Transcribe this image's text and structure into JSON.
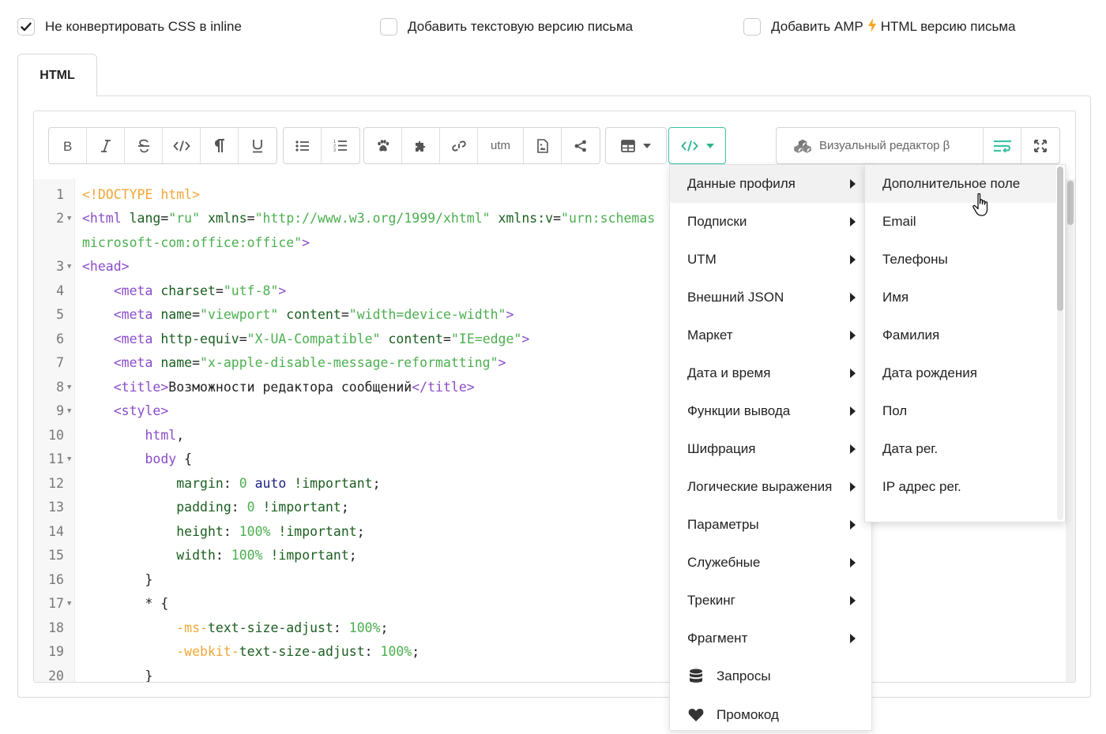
{
  "options": [
    {
      "label": "Не конвертировать CSS в inline",
      "checked": true
    },
    {
      "label": "Добавить текстовую версию письма",
      "checked": false
    },
    {
      "label_before": "Добавить AMP",
      "label_after": "HTML версию письма",
      "checked": false
    }
  ],
  "tab": {
    "label": "HTML"
  },
  "toolbar": {
    "utm_label": "utm",
    "visual_editor_label": "Визуальный редактор β",
    "icons": [
      "bold-icon",
      "italic-icon",
      "strikethrough-icon",
      "code-icon",
      "paragraph-icon",
      "underline-icon",
      "bullet-list-icon",
      "numbered-list-icon",
      "paw-icon",
      "puzzle-icon",
      "link-icon",
      "utm",
      "file-image-icon",
      "share-icon",
      "table-icon",
      "code-insert-icon",
      "visual-editor-icon",
      "wrap-icon",
      "fullscreen-icon"
    ],
    "accent_color": "#3dc2a5"
  },
  "code": {
    "lines": [
      {
        "n": "1",
        "fold": false
      },
      {
        "n": "2",
        "fold": true
      },
      {
        "n": "",
        "fold": false
      },
      {
        "n": "3",
        "fold": true
      },
      {
        "n": "4",
        "fold": false
      },
      {
        "n": "5",
        "fold": false
      },
      {
        "n": "6",
        "fold": false
      },
      {
        "n": "7",
        "fold": false
      },
      {
        "n": "8",
        "fold": true
      },
      {
        "n": "9",
        "fold": true
      },
      {
        "n": "10",
        "fold": false
      },
      {
        "n": "11",
        "fold": true
      },
      {
        "n": "12",
        "fold": false
      },
      {
        "n": "13",
        "fold": false
      },
      {
        "n": "14",
        "fold": false
      },
      {
        "n": "15",
        "fold": false
      },
      {
        "n": "16",
        "fold": false
      },
      {
        "n": "17",
        "fold": true
      },
      {
        "n": "18",
        "fold": false
      },
      {
        "n": "19",
        "fold": false
      },
      {
        "n": "20",
        "fold": false
      }
    ],
    "l1_doctype": "<!DOCTYPE html>",
    "l2_open": "<html",
    "l2_lang_attr": " lang",
    "l2_lang_val": "\"ru\"",
    "l2_xmlns_attr": " xmlns",
    "l2_xmlns_val": "\"http://www.w3.org/1999/xhtml\"",
    "l2_xmlnsv_attr": " xmlns:v",
    "l2_xmlnsv_val": "\"urn:schemas",
    "l2b_cont": "microsoft-com:office:office\"",
    "l2b_close": ">",
    "l3": "<head>",
    "meta_tag": "<meta",
    "close_bracket": ">",
    "l4_attr": " charset",
    "l4_val": "\"utf-8\"",
    "l5_attr1": " name",
    "l5_val1": "\"viewport\"",
    "l5_attr2": " content",
    "l5_val2": "\"width=device-width\"",
    "l6_attr1": " http-equiv",
    "l6_val1": "\"X-UA-Compatible\"",
    "l6_attr2": " content",
    "l6_val2": "\"IE=edge\"",
    "l7_attr": " name",
    "l7_val": "\"x-apple-disable-message-reformatting\"",
    "l8_open": "<title>",
    "l8_text": "Возможности редактора сообщений",
    "l8_close": "</title>",
    "l9": "<style>",
    "l10_sel": "html",
    "l10_comma": ",",
    "l11_sel": "body",
    "l11_brace": " {",
    "l12_prop": "margin",
    "l12_num": "0",
    "l12_kw": "auto",
    "l12_imp": "!important",
    "l13_prop": "padding",
    "l13_num": "0",
    "l13_imp": "!important",
    "l14_prop": "height",
    "l14_num": "100%",
    "l14_imp": "!important",
    "l15_prop": "width",
    "l15_num": "100%",
    "l15_imp": "!important",
    "l16": "}",
    "l17": "* {",
    "l18_vendor": "-ms-",
    "l18_prop": "text-size-adjust",
    "l18_num": "100%",
    "l19_vendor": "-webkit-",
    "l19_prop": "text-size-adjust",
    "l19_num": "100%",
    "l20": "}",
    "colon": ":",
    "semicolon": ";",
    "eq": "="
  },
  "menu": {
    "items": [
      {
        "label": "Данные профиля",
        "submenu": true,
        "highlighted": true
      },
      {
        "label": "Подписки",
        "submenu": true
      },
      {
        "label": "UTM",
        "submenu": true
      },
      {
        "label": "Внешний JSON",
        "submenu": true
      },
      {
        "label": "Маркет",
        "submenu": true
      },
      {
        "label": "Дата и время",
        "submenu": true
      },
      {
        "label": "Функции вывода",
        "submenu": true
      },
      {
        "label": "Шифрация",
        "submenu": true
      },
      {
        "label": "Логические выражения",
        "submenu": true
      },
      {
        "label": "Параметры",
        "submenu": true
      },
      {
        "label": "Служебные",
        "submenu": true
      },
      {
        "label": "Трекинг",
        "submenu": true
      },
      {
        "label": "Фрагмент",
        "submenu": true
      },
      {
        "label": "Запросы",
        "icon": "database-icon"
      },
      {
        "label": "Промокод",
        "icon": "heart-icon"
      }
    ]
  },
  "submenu": {
    "items": [
      {
        "label": "Дополнительное поле",
        "highlighted": true
      },
      {
        "label": "Email"
      },
      {
        "label": "Телефоны"
      },
      {
        "label": "Имя"
      },
      {
        "label": "Фамилия"
      },
      {
        "label": "Дата рождения"
      },
      {
        "label": "Пол"
      },
      {
        "label": "Дата рег."
      },
      {
        "label": "IP адрес рег."
      }
    ]
  }
}
